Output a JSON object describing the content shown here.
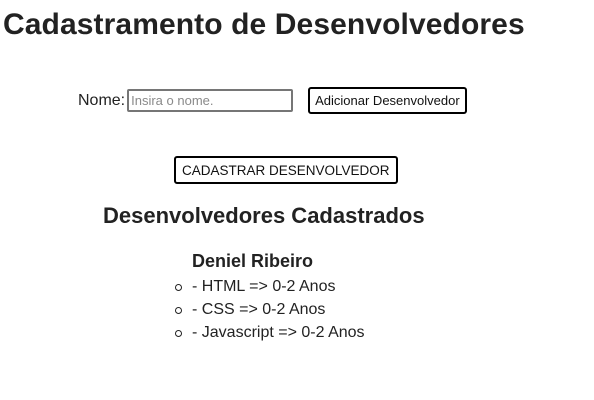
{
  "page": {
    "title": "Cadastramento de Desenvolvedores"
  },
  "form": {
    "name_label": "Nome:",
    "name_input_value": "",
    "name_input_placeholder": "Insira o nome.",
    "add_button_label": "Adicionar Desenvolvedor"
  },
  "register_button_label": "CADASTRAR DESENVOLVEDOR",
  "registered": {
    "section_title": "Desenvolvedores Cadastrados",
    "developers": [
      {
        "name": "Deniel Ribeiro",
        "skills": [
          "- HTML => 0-2 Anos",
          "- CSS => 0-2 Anos",
          "- Javascript => 0-2 Anos"
        ]
      }
    ]
  }
}
